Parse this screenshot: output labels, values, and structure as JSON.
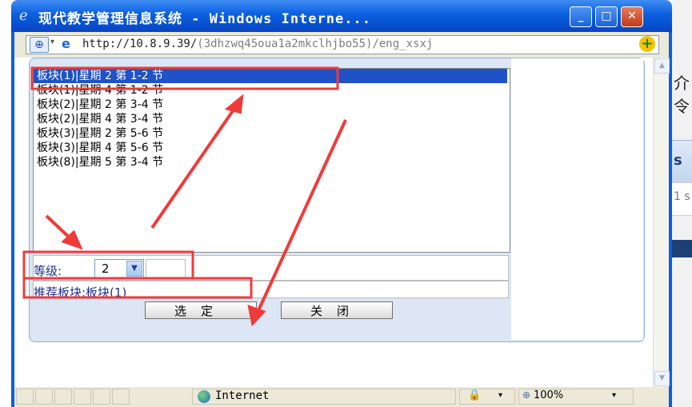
{
  "window": {
    "title": "现代教学管理信息系统 - Windows Interne...",
    "minimize": "_",
    "maximize": "□",
    "close": "✕"
  },
  "address": {
    "url_host": "http://10.8.9.39/",
    "url_path": "(3dhzwq45oua1a2mkclhjbo55)/eng_xsxj"
  },
  "list": {
    "items": [
      "板块(1)|星期 2 第 1-2 节",
      "板块(1)|星期 4 第 1-2 节",
      "板块(2)|星期 2 第 3-4 节",
      "板块(2)|星期 4 第 3-4 节",
      "板块(3)|星期 2 第 5-6 节",
      "板块(3)|星期 4 第 5-6 节",
      "板块(8)|星期 5 第 3-4 节"
    ],
    "selected_index": 0
  },
  "form": {
    "grade_label": "等级:",
    "grade_value": "2",
    "recommend_text": "推荐板块:板块(1)",
    "select_button": "选定",
    "close_button": "关闭"
  },
  "status": {
    "zone": "Internet",
    "zoom": "100%"
  },
  "background": {
    "right_fragment_1": "介令",
    "right_fragment_2": "s",
    "right_fragment_3": "1 s"
  },
  "colors": {
    "titlebar": "#0a5fe0",
    "selection": "#1f52c6",
    "annotation": "#f03a3a"
  }
}
